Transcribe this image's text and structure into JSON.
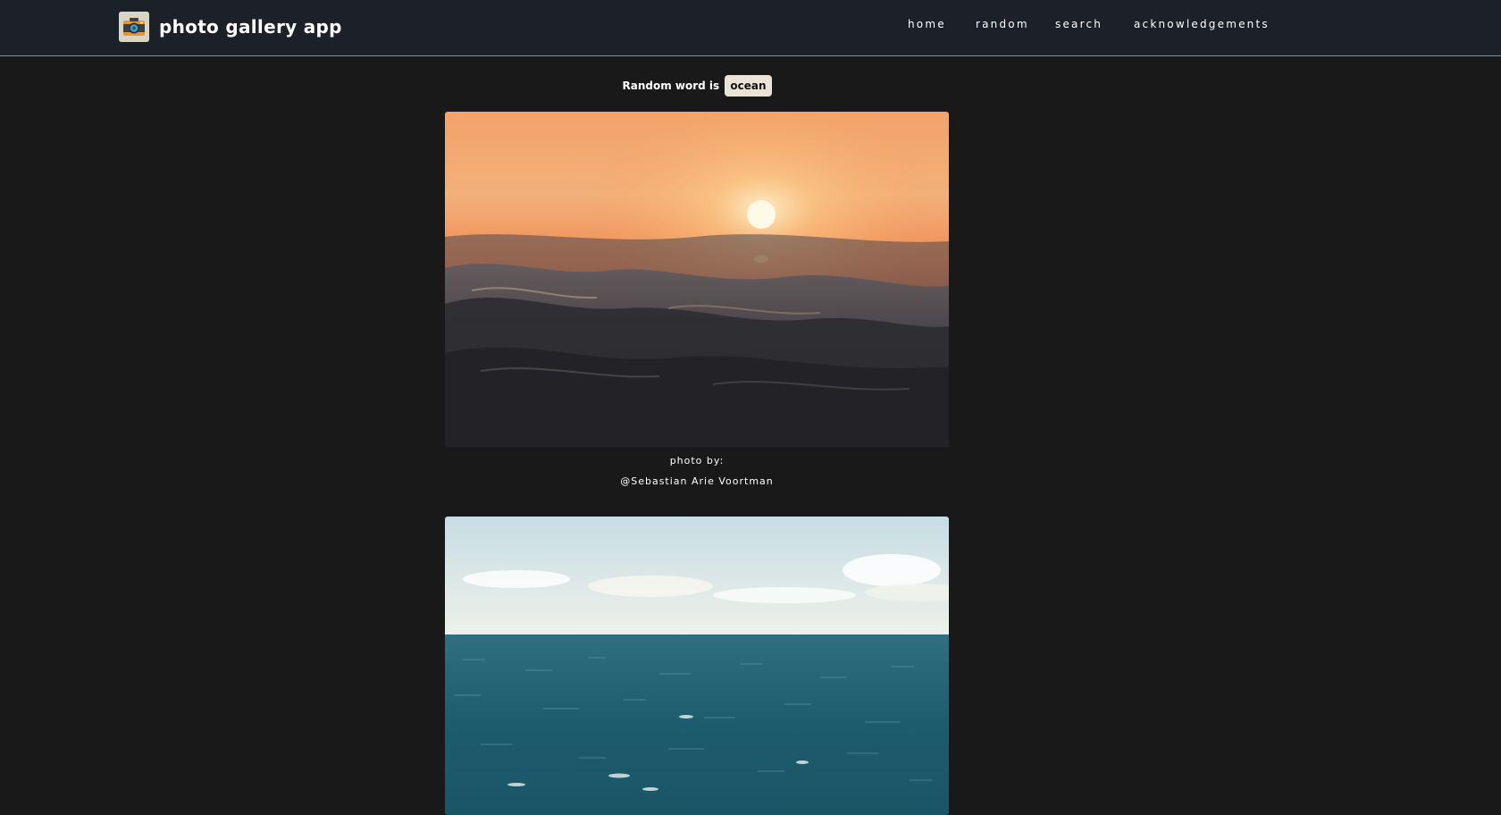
{
  "app": {
    "title": "photo gallery app",
    "logo_icon": "camera-icon"
  },
  "nav": {
    "items": [
      {
        "label": "home"
      },
      {
        "label": "random"
      },
      {
        "label": "search"
      },
      {
        "label": "acknowledgements"
      }
    ]
  },
  "random_word": {
    "prefix": "Random word is",
    "word": "ocean"
  },
  "photos": [
    {
      "credit_label": "photo by:",
      "photographer": "@Sebastian Arie Voortman"
    },
    {
      "credit_label": "",
      "photographer": ""
    }
  ],
  "colors": {
    "background": "#191919",
    "navbar": "#1b2029",
    "badge": "#e9e4d6"
  }
}
